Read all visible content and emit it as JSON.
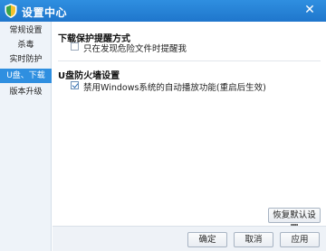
{
  "window": {
    "title": "设置中心",
    "close_symbol": "✕",
    "icon": "shield-icon",
    "colors": {
      "titlebar": "#1f76cc",
      "sidebar": "#eef3f9",
      "active_item": "#2f8fe0"
    }
  },
  "sidebar": {
    "items": [
      {
        "label": "常规设置",
        "active": false
      },
      {
        "label": "杀毒",
        "active": false
      },
      {
        "label": "实时防护",
        "active": false
      },
      {
        "label": "U盘、下载",
        "active": true
      },
      {
        "label": "版本升级",
        "active": false
      }
    ]
  },
  "sections": {
    "download": {
      "title": "下载保护提醒方式",
      "option_label": "只在发现危险文件时提醒我",
      "option_checked": false
    },
    "usb": {
      "title": "U盘防火墙设置",
      "option_label": "禁用Windows系统的自动播放功能(重启后生效)",
      "option_checked": true
    }
  },
  "buttons": {
    "restore": "恢复默认设置",
    "ok": "确定",
    "cancel": "取消",
    "apply": "应用"
  }
}
